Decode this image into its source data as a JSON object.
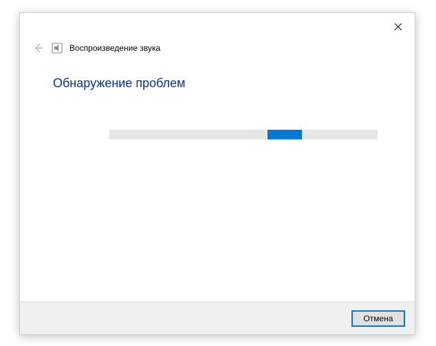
{
  "header": {
    "title": "Воспроизведение звука"
  },
  "main": {
    "heading": "Обнаружение проблем"
  },
  "footer": {
    "cancel_label": "Отмена"
  }
}
